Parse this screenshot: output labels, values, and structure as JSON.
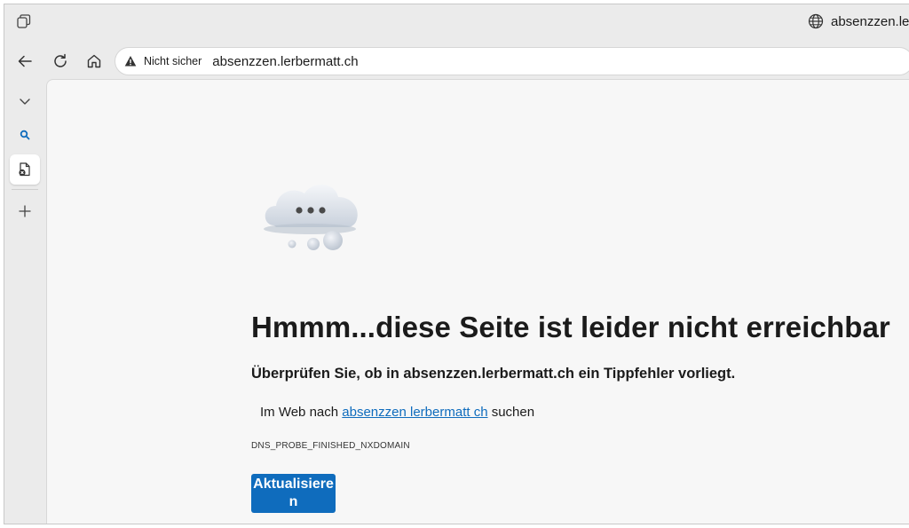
{
  "titlebar": {
    "tab_title": "absenzzen.lerbermatt.ch"
  },
  "toolbar": {
    "back": "back",
    "reload": "reload",
    "home": "home"
  },
  "address_bar": {
    "security_label": "Nicht sicher",
    "url": "absenzzen.lerbermatt.ch"
  },
  "error_page": {
    "headline": "Hmmm...diese Seite ist leider nicht erreichbar",
    "subline": "Überprüfen Sie, ob in absenzzen.lerbermatt.ch ein Tippfehler vorliegt.",
    "search_prefix": "Im Web nach",
    "search_link": "absenzzen lerbermatt ch",
    "search_suffix": "suchen",
    "error_code": "DNS_PROBE_FINISHED_NXDOMAIN",
    "reload_label": "Aktualisieren"
  },
  "colors": {
    "accent": "#0f6cbd",
    "window_bg": "#ebebeb",
    "page_bg": "#f7f7f7"
  },
  "icons": [
    "tab-actions-icon",
    "globe-icon",
    "back-arrow-icon",
    "reload-icon",
    "home-icon",
    "warning-icon",
    "chevron-down-icon",
    "search-icon",
    "tab-error-icon",
    "plus-icon",
    "cloud-icon"
  ]
}
